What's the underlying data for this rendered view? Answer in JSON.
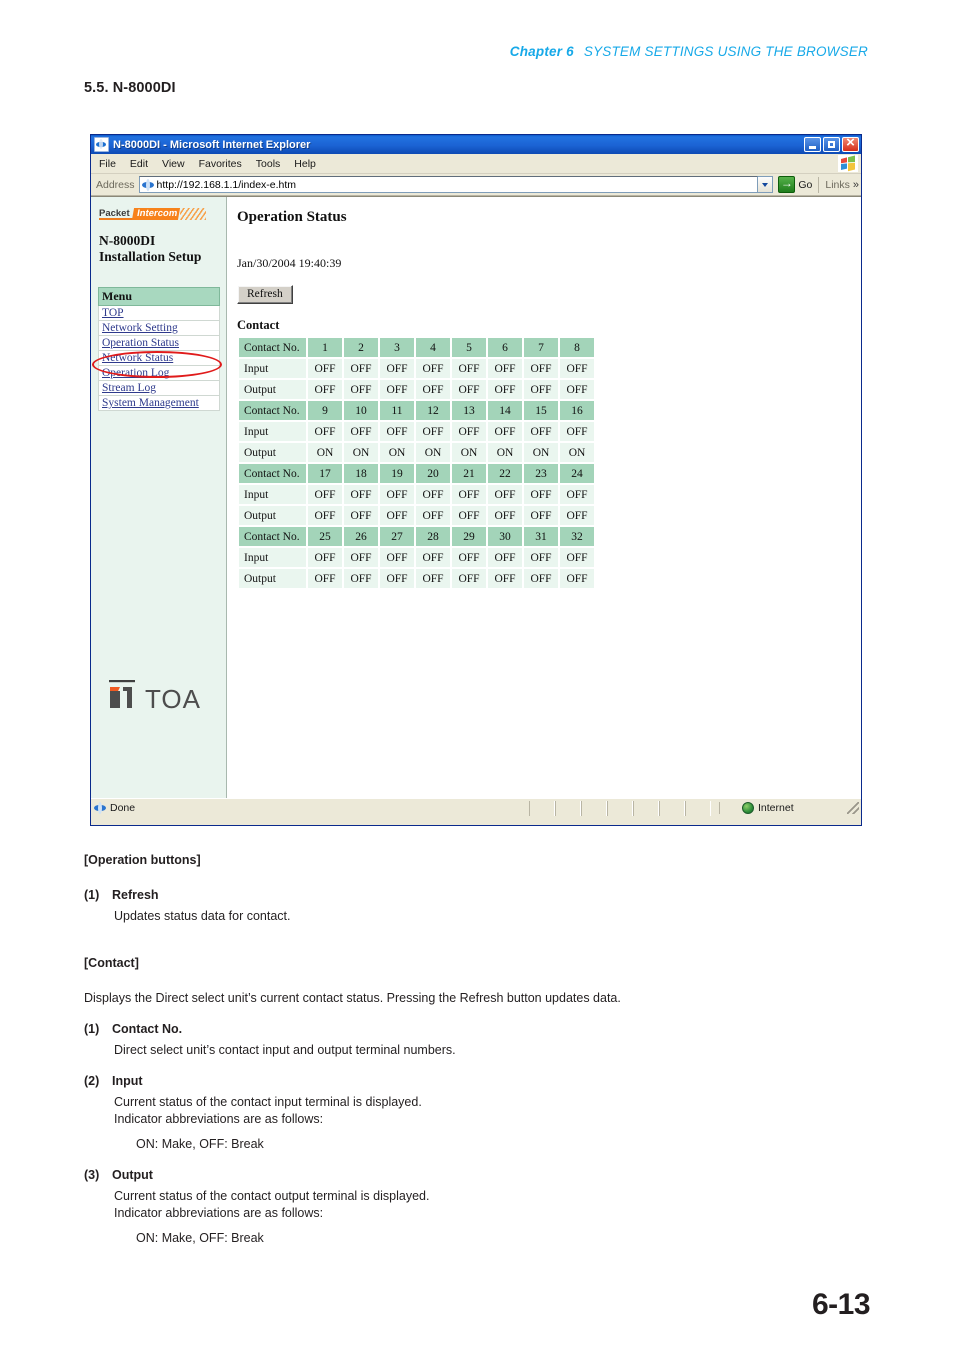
{
  "page": {
    "header_chapter": "Chapter 6",
    "header_title": "SYSTEM SETTINGS USING THE BROWSER",
    "section_title": "5.5. N-8000DI",
    "page_number": "6-13"
  },
  "browser": {
    "title": "N-8000DI - Microsoft Internet Explorer",
    "menu": [
      "File",
      "Edit",
      "View",
      "Favorites",
      "Tools",
      "Help"
    ],
    "address_label": "Address",
    "address_value": "http://192.168.1.1/index-e.htm",
    "go_label": "Go",
    "links_label": "Links",
    "links_chevron": "»",
    "status_text": "Done",
    "status_zone": "Internet",
    "window_controls": [
      "minimize-button",
      "maximize-button",
      "close-button"
    ]
  },
  "sidebar": {
    "logo_packet": "Packet",
    "logo_intercom": "Intercom",
    "product_line1": "N-8000DI",
    "product_line2": "Installation Setup",
    "menu_heading": "Menu",
    "menu_items": [
      "TOP",
      "Network Setting",
      "Operation Status",
      "Network Status",
      "Operation Log",
      "Stream Log",
      "System Management"
    ],
    "highlighted_item": "Operation Status",
    "brand_logo": "TOA"
  },
  "main": {
    "heading": "Operation Status",
    "timestamp": "Jan/30/2004 19:40:39",
    "refresh_button": "Refresh",
    "contact_label": "Contact",
    "row_labels": {
      "contact_no": "Contact No.",
      "input": "Input",
      "output": "Output"
    },
    "contact_blocks": [
      {
        "numbers": [
          "1",
          "2",
          "3",
          "4",
          "5",
          "6",
          "7",
          "8"
        ],
        "input": [
          "OFF",
          "OFF",
          "OFF",
          "OFF",
          "OFF",
          "OFF",
          "OFF",
          "OFF"
        ],
        "output": [
          "OFF",
          "OFF",
          "OFF",
          "OFF",
          "OFF",
          "OFF",
          "OFF",
          "OFF"
        ]
      },
      {
        "numbers": [
          "9",
          "10",
          "11",
          "12",
          "13",
          "14",
          "15",
          "16"
        ],
        "input": [
          "OFF",
          "OFF",
          "OFF",
          "OFF",
          "OFF",
          "OFF",
          "OFF",
          "OFF"
        ],
        "output": [
          "ON",
          "ON",
          "ON",
          "ON",
          "ON",
          "ON",
          "ON",
          "ON"
        ]
      },
      {
        "numbers": [
          "17",
          "18",
          "19",
          "20",
          "21",
          "22",
          "23",
          "24"
        ],
        "input": [
          "OFF",
          "OFF",
          "OFF",
          "OFF",
          "OFF",
          "OFF",
          "OFF",
          "OFF"
        ],
        "output": [
          "OFF",
          "OFF",
          "OFF",
          "OFF",
          "OFF",
          "OFF",
          "OFF",
          "OFF"
        ]
      },
      {
        "numbers": [
          "25",
          "26",
          "27",
          "28",
          "29",
          "30",
          "31",
          "32"
        ],
        "input": [
          "OFF",
          "OFF",
          "OFF",
          "OFF",
          "OFF",
          "OFF",
          "OFF",
          "OFF"
        ],
        "output": [
          "OFF",
          "OFF",
          "OFF",
          "OFF",
          "OFF",
          "OFF",
          "OFF",
          "OFF"
        ]
      }
    ]
  },
  "doc": {
    "operation_buttons_heading": "[Operation buttons]",
    "item1_num": "(1)",
    "item1_title": "Refresh",
    "item1_desc": "Updates status data for contact.",
    "contact_heading": "[Contact]",
    "contact_desc": "Displays the Direct select unit’s current contact status. Pressing the Refresh button updates data.",
    "c1_num": "(1)",
    "c1_title": "Contact No.",
    "c1_desc": "Direct select unit’s contact input and output terminal numbers.",
    "c2_num": "(2)",
    "c2_title": "Input",
    "c2_desc1": "Current status of the contact input terminal is displayed.",
    "c2_desc2": "Indicator abbreviations are as follows:",
    "c2_desc3": "ON: Make, OFF: Break",
    "c3_num": "(3)",
    "c3_title": "Output",
    "c3_desc1": "Current status of the contact output terminal is displayed.",
    "c3_desc2": "Indicator abbreviations are as follows:",
    "c3_desc3": "ON: Make, OFF: Break"
  },
  "colors": {
    "header_blue": "#17a9e8",
    "table_header_green": "#a3d4b9",
    "table_cell_mint": "#eaf6ef",
    "sidebar_bg": "#e9f4ee",
    "annotation_red": "#e01b1b",
    "brand_orange": "#f7821b",
    "titlebar_blue": "#1b63d4"
  }
}
